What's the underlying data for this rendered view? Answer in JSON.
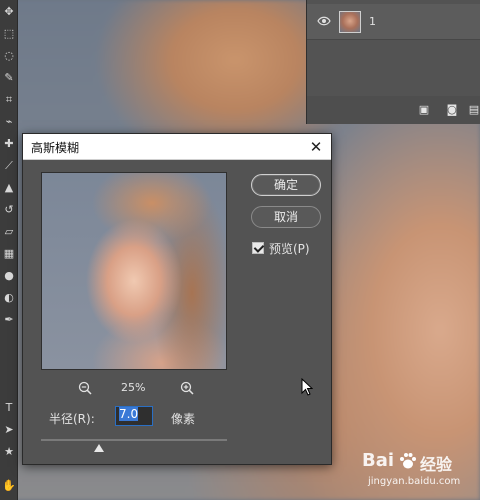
{
  "layers_panel": {
    "layer_name": "1"
  },
  "dialog": {
    "title": "高斯模糊",
    "close_symbol": "✕",
    "ok_label": "确定",
    "cancel_label": "取消",
    "preview_label": "预览(P)",
    "preview_checked": true,
    "zoom_level": "25%",
    "radius_label": "半径(R):",
    "radius_value": "7.0",
    "radius_unit": "像素",
    "slider_level_fraction": 0.31
  },
  "toolbar": {
    "tools": [
      "move-icon",
      "marquee-icon",
      "lasso-icon",
      "quick-select-icon",
      "crop-icon",
      "eyedropper-icon",
      "healing-icon",
      "brush-icon",
      "stamp-icon",
      "history-brush-icon",
      "eraser-icon",
      "gradient-icon",
      "blur-icon",
      "dodge-icon",
      "pen-icon",
      "type-icon",
      "path-select-icon",
      "shape-icon",
      "hand-icon"
    ]
  },
  "watermark": {
    "brand": "Bai",
    "brand_cn": "经验",
    "url": "jingyan.baidu.com"
  },
  "colors": {
    "dialog_bg": "#535353",
    "accent": "#3a79d6"
  }
}
